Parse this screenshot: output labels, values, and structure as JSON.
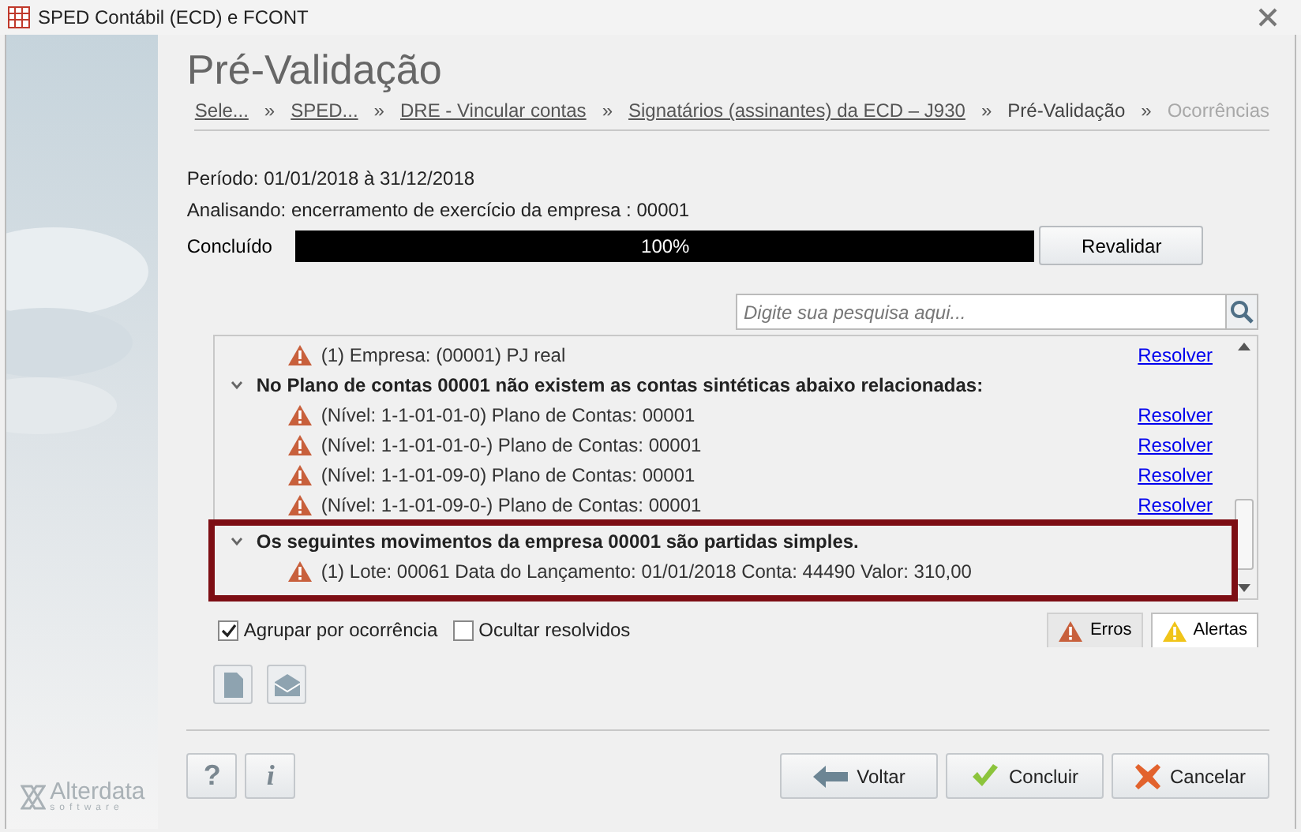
{
  "window": {
    "title": "SPED Contábil (ECD) e FCONT"
  },
  "page_title": "Pré-Validação",
  "breadcrumbs": [
    {
      "label": "Sele...",
      "link": true
    },
    {
      "label": "SPED...",
      "link": true
    },
    {
      "label": "DRE - Vincular contas",
      "link": true
    },
    {
      "label": "Signatários (assinantes) da ECD – J930",
      "link": true
    },
    {
      "label": "Pré-Validação",
      "link": false,
      "selected": true
    },
    {
      "label": "Ocorrências",
      "link": false,
      "selected": false
    }
  ],
  "separator": "»",
  "period": "Período: 01/01/2018 à 31/12/2018",
  "analyzing": "Analisando: encerramento de exercício da empresa : 00001",
  "progress": {
    "label": "Concluído",
    "level": 1,
    "reading": "100%"
  },
  "revalidate_button": "Revalidar",
  "search": {
    "placeholder": "Digite sua pesquisa aqui..."
  },
  "tree": [
    {
      "highlighted": false,
      "children": [
        {
          "text": "(1) Empresa: (00001) PJ real",
          "action": "Resolver"
        }
      ]
    },
    {
      "title": "No Plano de contas 00001 não existem as contas sintéticas abaixo relacionadas:",
      "expanded": true,
      "highlighted": false,
      "children": [
        {
          "text": "(Nível: 1-1-01-01-0) Plano de Contas: 00001",
          "action": "Resolver"
        },
        {
          "text": "(Nível: 1-1-01-01-0-) Plano de Contas: 00001",
          "action": "Resolver"
        },
        {
          "text": "(Nível: 1-1-01-09-0) Plano de Contas: 00001",
          "action": "Resolver"
        },
        {
          "text": "(Nível: 1-1-01-09-0-) Plano de Contas: 00001",
          "action": "Resolver"
        }
      ]
    },
    {
      "title": "Os seguintes movimentos da empresa 00001 são partidas simples.",
      "expanded": true,
      "highlighted": true,
      "children": [
        {
          "text": "(1) Lote: 00061 Data do Lançamento: 01/01/2018 Conta: 44490 Valor: 310,00"
        }
      ]
    }
  ],
  "options": [
    {
      "label": "Agrupar por ocorrência",
      "checked": true
    },
    {
      "label": "Ocultar resolvidos",
      "checked": false
    }
  ],
  "filter_tabs": [
    {
      "kind": "error",
      "label": "Erros",
      "selected": false
    },
    {
      "kind": "alert",
      "label": "Alertas",
      "selected": true
    }
  ],
  "help_buttons": [
    {
      "kind": "help",
      "label": "?"
    },
    {
      "kind": "info",
      "label": "i"
    }
  ],
  "logo": {
    "name": "Alterdata",
    "tagline": "software"
  },
  "footer_buttons": [
    {
      "kind": "back",
      "label": "Voltar"
    },
    {
      "kind": "ok",
      "label": "Concluir"
    },
    {
      "kind": "cancel",
      "label": "Cancelar"
    }
  ]
}
